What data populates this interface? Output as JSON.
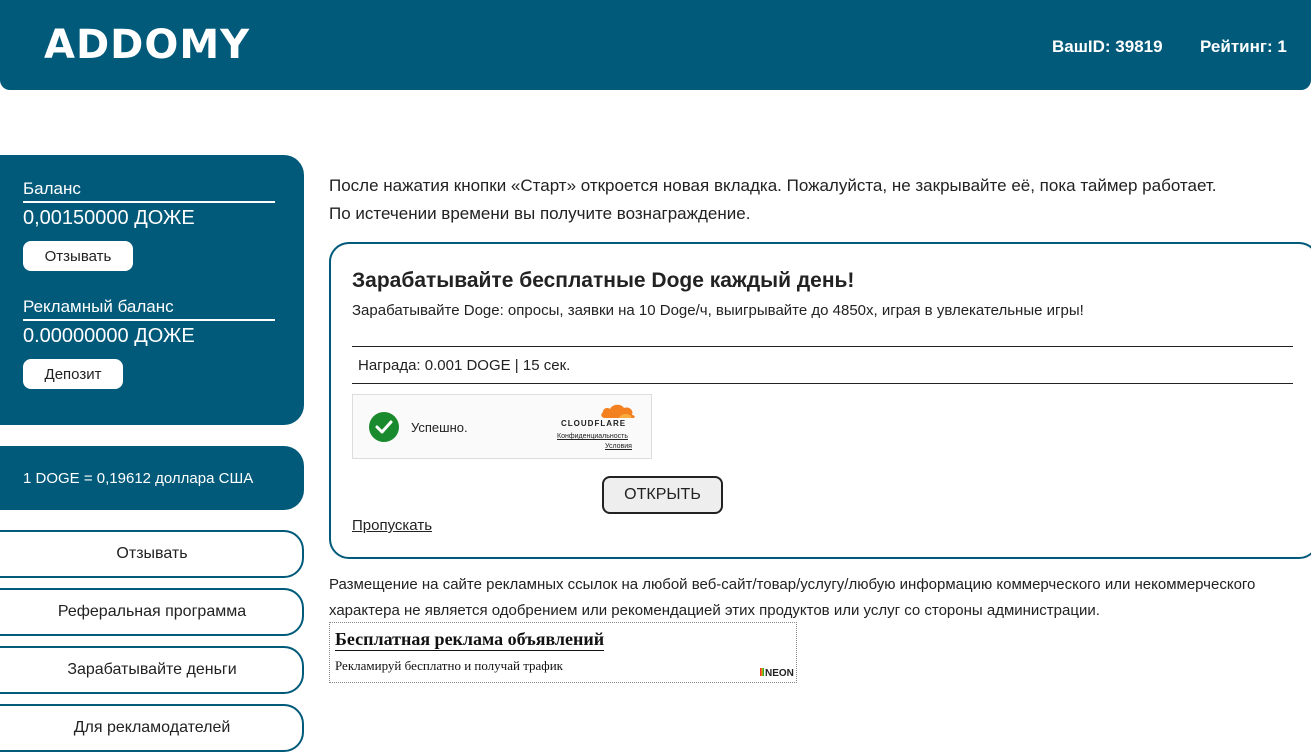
{
  "header": {
    "logo": "ADDOMY",
    "user_id": "ВашID: 39819",
    "rating": "Рейтинг: 1",
    "bg_color": "#015a7a"
  },
  "balance": {
    "label": "Баланс",
    "value": "0,00150000 ДОЖЕ",
    "withdraw_label": "Отзывать",
    "ad_label": "Рекламный баланс",
    "ad_value": "0.00000000 ДОЖЕ",
    "deposit_label": "Депозит"
  },
  "rate": {
    "text": "1 DOGE = 0,19612 доллара США"
  },
  "nav": {
    "items": [
      "Отзывать",
      "Реферальная программа",
      "Зарабатывайте деньги",
      "Для рекламодателей"
    ]
  },
  "notice": {
    "line1": "После нажатия кнопки «Старт» откроется новая вкладка. Пожалуйста, не закрывайте её, пока таймер работает.",
    "line2": "По истечении времени вы получите вознаграждение."
  },
  "task": {
    "title": "Зарабатывайте бесплатные Doge каждый день!",
    "description": "Зарабатывайте Doge: опросы, заявки на 10 Doge/ч, выигрывайте до 4850х, играя в увлекательные игры!",
    "reward": "Награда: 0.001 DOGE | 15 сек.",
    "captcha_status": "Успешно.",
    "captcha_brand": "CLOUDFLARE",
    "captcha_privacy": "Конфиденциальность",
    "captcha_terms": "Условия",
    "open_label": "ОТКРЫТЬ",
    "skip_label": "Пропускать"
  },
  "disclaimer": {
    "line1": "Размещение на сайте рекламных ссылок на любой веб-сайт/товар/услугу/любую информацию коммерческого или некоммерческого",
    "line2": "характера не является одобрением или рекомендацией этих продуктов или услуг со стороны администрации."
  },
  "ad": {
    "title": "Бесплатная реклама объявлений",
    "text": "Рекламируй бесплатно и получай трафик",
    "brand": "NEON"
  }
}
